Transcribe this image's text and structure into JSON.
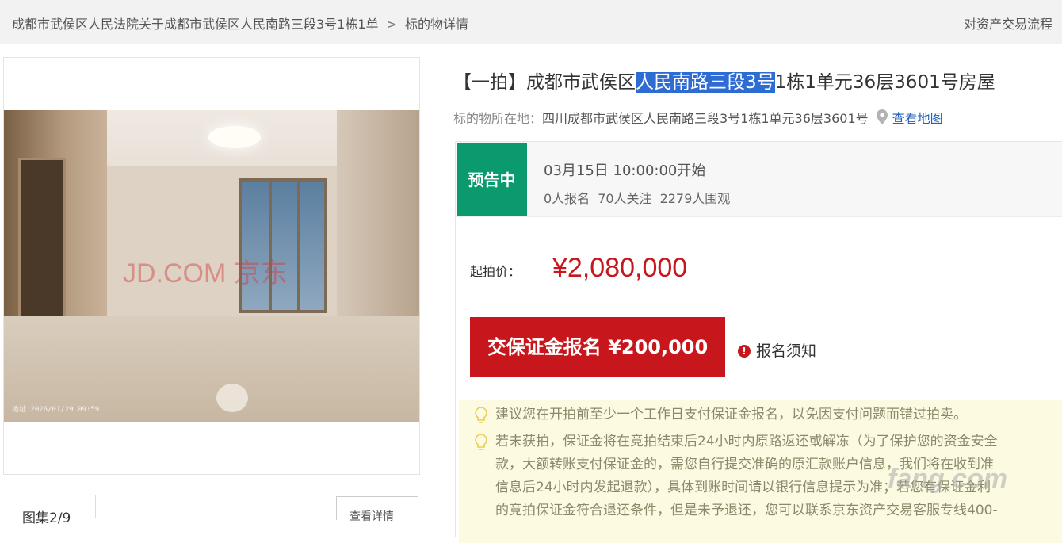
{
  "breadcrumb": {
    "parent": "成都市武侯区人民法院关于成都市武侯区人民南路三段3号1栋1单",
    "separator": ">",
    "current": "标的物详情"
  },
  "top_link": "对资产交易流程",
  "gallery": {
    "tab_label": "图集2/9",
    "detail_button": "查看详情",
    "photo_watermark": "JD.COM 京东",
    "photo_stamp": "地址 2026/01/29 09:59"
  },
  "listing": {
    "title_prefix": "【一拍】成都市武侯区",
    "title_highlight": "人民南路三段3号",
    "title_suffix": "1栋1单元36层3601号房屋",
    "location_label": "标的物所在地：",
    "location_value": "四川成都市武侯区人民南路三段3号1栋1单元36层3601号",
    "map_link": "查看地图"
  },
  "status": {
    "badge": "预告中",
    "start_time": "03月15日 10:00:00开始",
    "signups": "0人报名",
    "followers": "70人关注",
    "viewers": "2279人围观"
  },
  "price": {
    "label": "起拍价：",
    "value": "¥2,080,000"
  },
  "actions": {
    "deposit_button": "交保证金报名 ¥200,000",
    "notice_link": "报名须知"
  },
  "tips": [
    "建议您在开拍前至少一个工作日支付保证金报名，以免因支付问题而错过拍卖。",
    "若未获拍，保证金将在竞拍结束后24小时内原路返还或解冻（为了保护您的资金安全",
    "款，大额转账支付保证金的，需您自行提交准确的原汇款账户信息，我们将在收到准",
    "信息后24小时内发起退款），具体到账时间请以银行信息提示为准；若您有保证金利",
    "的竞拍保证金符合退还条件，但是未予退还，您可以联系京东资产交易客服专线400-"
  ],
  "site_watermark": "fang.com",
  "colors": {
    "accent_red": "#c8161d",
    "status_green": "#0a9a6d",
    "link_blue": "#1f5fbd",
    "tip_bg": "#fdfae2"
  }
}
